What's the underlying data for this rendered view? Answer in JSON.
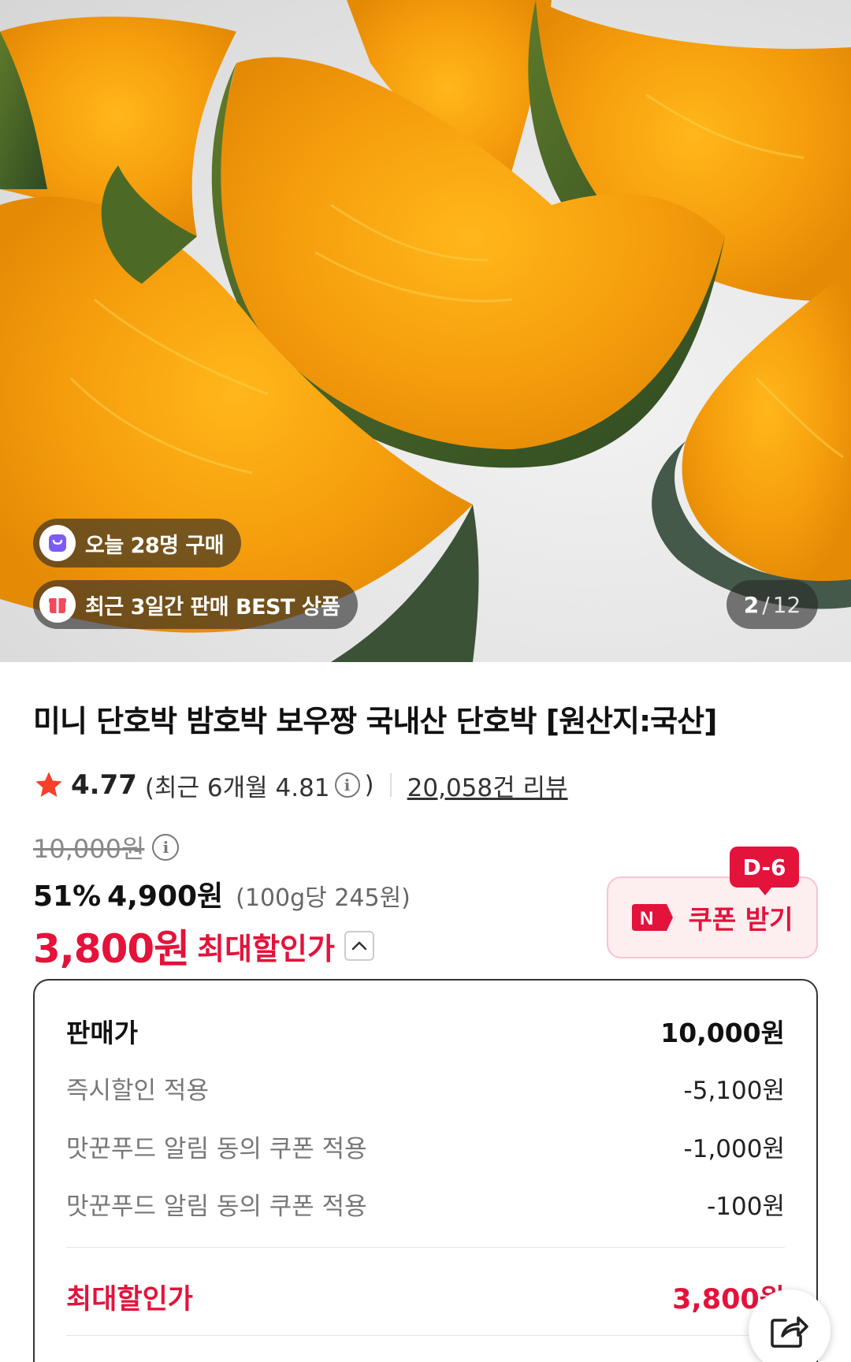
{
  "hero": {
    "badge_today": "오늘 28명 구매",
    "badge_best": "최근 3일간 판매 BEST 상품",
    "counter_current": "2",
    "counter_sep": "/",
    "counter_total": "12"
  },
  "product": {
    "title": "미니 단호박 밤호박 보우짱 국내산 단호박 [원산지:국산]",
    "rating": "4.77",
    "recent_prefix": "(최근 6개월 4.81",
    "recent_suffix": ")",
    "reviews": "20,058건 리뷰",
    "original_price": "10,000원",
    "discount_rate": "51%",
    "discount_price": "4,900원",
    "unit_price": "(100g당 245원)",
    "final_price": "3,800원",
    "final_label": "최대할인가"
  },
  "coupon": {
    "dday": "D-6",
    "label": "쿠폰 받기",
    "color": "#e3133b"
  },
  "breakdown": {
    "rows": [
      {
        "label": "판매가",
        "value": "10,000원"
      },
      {
        "label": "즉시할인 적용",
        "value": "-5,100원"
      },
      {
        "label": "맛꾼푸드 알림 동의 쿠폰 적용",
        "value": "-1,000원"
      },
      {
        "label": "맛꾼푸드 알림 동의 쿠폰 적용",
        "value": "-100원"
      }
    ],
    "total_label": "최대할인가",
    "total_value": "3,800원"
  },
  "icons": {
    "share": "share-icon",
    "star": "star-icon",
    "info": "info-icon"
  }
}
